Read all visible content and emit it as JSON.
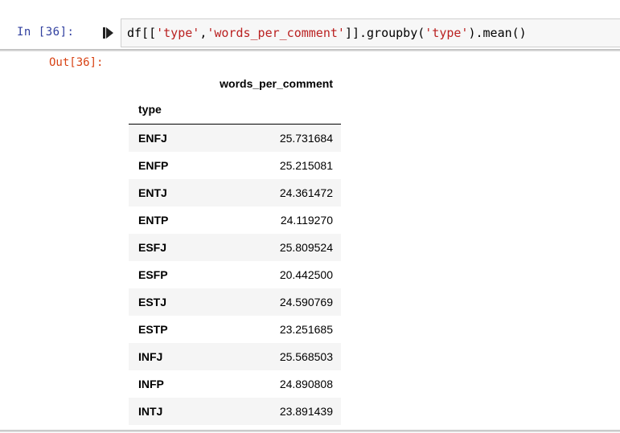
{
  "input": {
    "prompt": "In [36]:",
    "code": {
      "p1": "df[[",
      "s1": "'type'",
      "p2": ",",
      "s2": "'words_per_comment'",
      "p3": "]].groupby(",
      "s3": "'type'",
      "p4": ").mean()"
    }
  },
  "output": {
    "prompt": "Out[36]:",
    "table": {
      "column_header": "words_per_comment",
      "index_name": "type",
      "rows": [
        {
          "type": "ENFJ",
          "value": "25.731684"
        },
        {
          "type": "ENFP",
          "value": "25.215081"
        },
        {
          "type": "ENTJ",
          "value": "24.361472"
        },
        {
          "type": "ENTP",
          "value": "24.119270"
        },
        {
          "type": "ESFJ",
          "value": "25.809524"
        },
        {
          "type": "ESFP",
          "value": "20.442500"
        },
        {
          "type": "ESTJ",
          "value": "24.590769"
        },
        {
          "type": "ESTP",
          "value": "23.251685"
        },
        {
          "type": "INFJ",
          "value": "25.568503"
        },
        {
          "type": "INFP",
          "value": "24.890808"
        },
        {
          "type": "INTJ",
          "value": "23.891439"
        }
      ]
    }
  }
}
